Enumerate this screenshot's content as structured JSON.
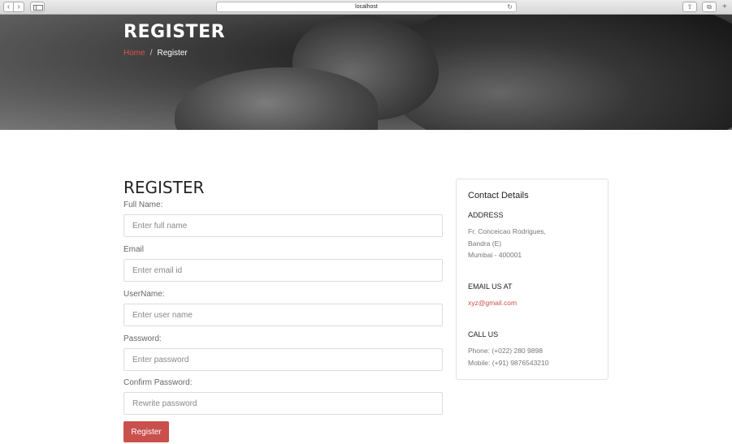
{
  "browser": {
    "url": "localhost",
    "back_icon": "chevron-left-icon",
    "forward_icon": "chevron-right-icon",
    "reload_glyph": "↻",
    "share_glyph": "⇧",
    "tabs_glyph": "⧉",
    "new_tab_glyph": "+"
  },
  "hero": {
    "title": "REGISTER",
    "breadcrumb": {
      "home": "Home",
      "separator": "/",
      "current": "Register"
    }
  },
  "form": {
    "title": "REGISTER",
    "fields": [
      {
        "label": "Full Name:",
        "placeholder": "Enter full name",
        "value": ""
      },
      {
        "label": "Email",
        "placeholder": "Enter email id",
        "value": ""
      },
      {
        "label": "UserName:",
        "placeholder": "Enter user name",
        "value": ""
      },
      {
        "label": "Password:",
        "placeholder": "Enter password",
        "value": ""
      },
      {
        "label": "Confirm Password:",
        "placeholder": "Rewrite password",
        "value": ""
      }
    ],
    "submit_label": "Register"
  },
  "contact": {
    "title": "Contact Details",
    "address_heading": "ADDRESS",
    "address_lines": [
      "Fr. Conceicao Rodrigues,",
      "Bandra (E)",
      "Mumbai - 400001"
    ],
    "email_heading": "EMAIL US AT",
    "email": "xyz@gmail.com",
    "call_heading": "CALL US",
    "phone": "Phone: (+022) 280 9898",
    "mobile": "Mobile: (+91) 9876543210"
  },
  "colors": {
    "accent": "#c9504d",
    "breadcrumb_home": "#d9534f"
  }
}
